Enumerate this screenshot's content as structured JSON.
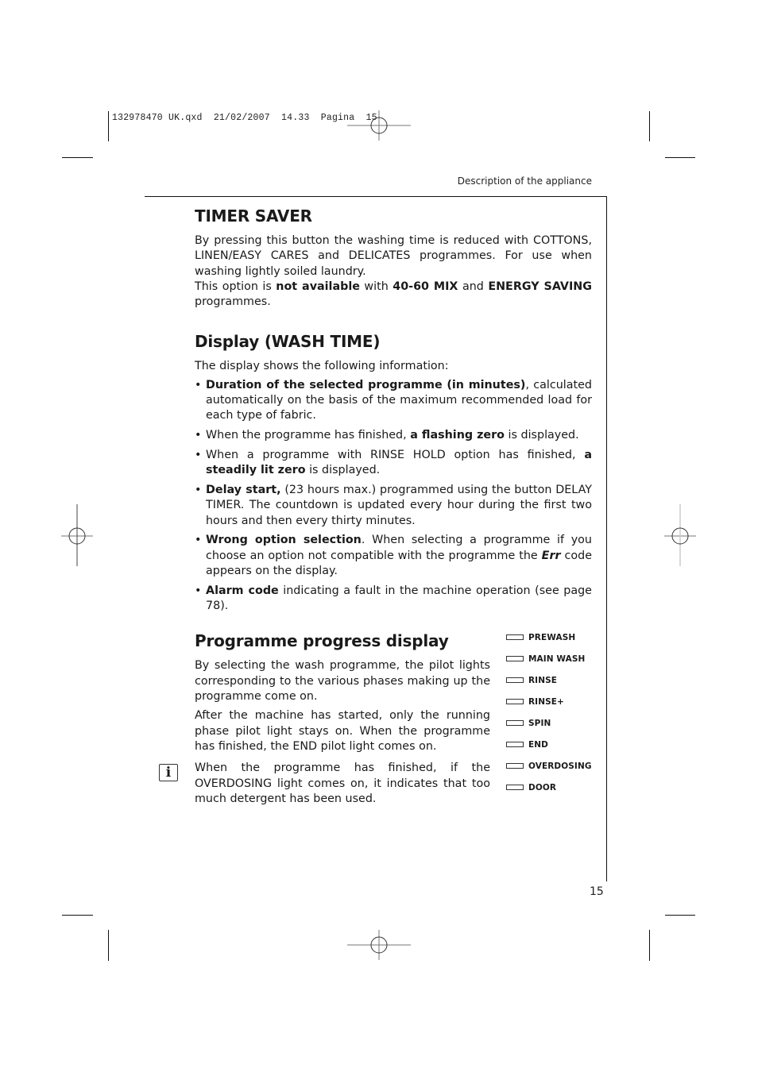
{
  "print_slug": "132978470 UK.qxd  21/02/2007  14.33  Pagina  15",
  "running_head": "Description of the appliance",
  "page_number": "15",
  "timer_saver": {
    "title": "TIMER SAVER",
    "p1": "By pressing this button the washing time is reduced with COTTONS, LINEN/EASY CARES and DELICATES programmes. For use when washing lightly soiled laundry.",
    "p2_a": "This option is ",
    "p2_b": "not available",
    "p2_c": " with ",
    "p2_d": "40-60 MIX",
    "p2_e": " and ",
    "p2_f": "ENERGY SAVING",
    "p2_g": " programmes."
  },
  "display": {
    "title": "Display (WASH TIME)",
    "intro": "The display shows the following information:",
    "items": [
      {
        "bold": "Duration of the selected programme (in minutes)",
        "text": ", calculated automatically on the basis of the maximum recommended load for each type of fabric."
      },
      {
        "pre": "When the programme has finished, ",
        "bold": "a flashing zero",
        "text": " is displayed."
      },
      {
        "pre": "When a programme with RINSE HOLD option has finished, ",
        "bold": "a steadily lit zero",
        "text": " is displayed."
      },
      {
        "bold": "Delay start,",
        "text": " (23 hours max.) programmed using the button DELAY TIMER. The countdown is updated every hour during the first two hours and then every thirty minutes."
      },
      {
        "bold": "Wrong option selection",
        "text": ". When selecting a programme if you choose an option not compatible with the programme the ",
        "italic": "Err",
        "post": " code appears on the display."
      },
      {
        "bold": "Alarm code",
        "text": " indicating a fault in the machine operation (see page 78)."
      }
    ]
  },
  "progress": {
    "title": "Programme progress display",
    "p1": "By selecting the wash programme, the pilot lights corresponding to the various phases making up the programme come on.",
    "p2": "After the machine has started, only the running phase pilot light stays on. When the programme has finished, the END pilot light comes on.",
    "note": "When the programme has finished, if the OVERDOSING light comes on, it indicates that too much detergent has been used.",
    "info_icon": "i",
    "lights": [
      "PREWASH",
      "MAIN WASH",
      "RINSE",
      "RINSE+",
      "SPIN",
      "END",
      "OVERDOSING",
      "DOOR"
    ]
  }
}
